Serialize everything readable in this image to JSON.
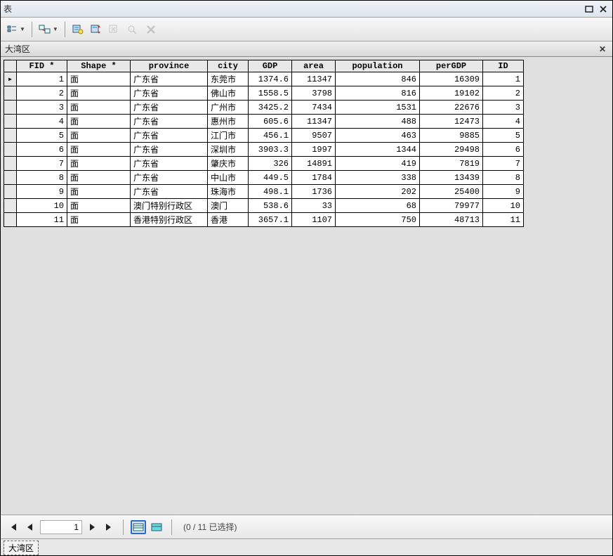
{
  "window": {
    "title": "表"
  },
  "tab": {
    "title": "大湾区"
  },
  "nav": {
    "pos": "1",
    "status": "(0 / 11 已选择)"
  },
  "bottom_tab": "大湾区",
  "columns": [
    "FID *",
    "Shape *",
    "province",
    "city",
    "GDP",
    "area",
    "population",
    "perGDP",
    "ID"
  ],
  "rows": [
    {
      "fid": "1",
      "shape": "面",
      "province": "广东省",
      "city": "东莞市",
      "gdp": "1374.6",
      "area": "11347",
      "population": "846",
      "pergdp": "16309",
      "id": "1"
    },
    {
      "fid": "2",
      "shape": "面",
      "province": "广东省",
      "city": "佛山市",
      "gdp": "1558.5",
      "area": "3798",
      "population": "816",
      "pergdp": "19102",
      "id": "2"
    },
    {
      "fid": "3",
      "shape": "面",
      "province": "广东省",
      "city": "广州市",
      "gdp": "3425.2",
      "area": "7434",
      "population": "1531",
      "pergdp": "22676",
      "id": "3"
    },
    {
      "fid": "4",
      "shape": "面",
      "province": "广东省",
      "city": "惠州市",
      "gdp": "605.6",
      "area": "11347",
      "population": "488",
      "pergdp": "12473",
      "id": "4"
    },
    {
      "fid": "5",
      "shape": "面",
      "province": "广东省",
      "city": "江门市",
      "gdp": "456.1",
      "area": "9507",
      "population": "463",
      "pergdp": "9885",
      "id": "5"
    },
    {
      "fid": "6",
      "shape": "面",
      "province": "广东省",
      "city": "深圳市",
      "gdp": "3903.3",
      "area": "1997",
      "population": "1344",
      "pergdp": "29498",
      "id": "6"
    },
    {
      "fid": "7",
      "shape": "面",
      "province": "广东省",
      "city": "肇庆市",
      "gdp": "326",
      "area": "14891",
      "population": "419",
      "pergdp": "7819",
      "id": "7"
    },
    {
      "fid": "8",
      "shape": "面",
      "province": "广东省",
      "city": "中山市",
      "gdp": "449.5",
      "area": "1784",
      "population": "338",
      "pergdp": "13439",
      "id": "8"
    },
    {
      "fid": "9",
      "shape": "面",
      "province": "广东省",
      "city": "珠海市",
      "gdp": "498.1",
      "area": "1736",
      "population": "202",
      "pergdp": "25400",
      "id": "9"
    },
    {
      "fid": "10",
      "shape": "面",
      "province": "澳门特别行政区",
      "city": "澳门",
      "gdp": "538.6",
      "area": "33",
      "population": "68",
      "pergdp": "79977",
      "id": "10"
    },
    {
      "fid": "11",
      "shape": "面",
      "province": "香港特别行政区",
      "city": "香港",
      "gdp": "3657.1",
      "area": "1107",
      "population": "750",
      "pergdp": "48713",
      "id": "11"
    }
  ]
}
